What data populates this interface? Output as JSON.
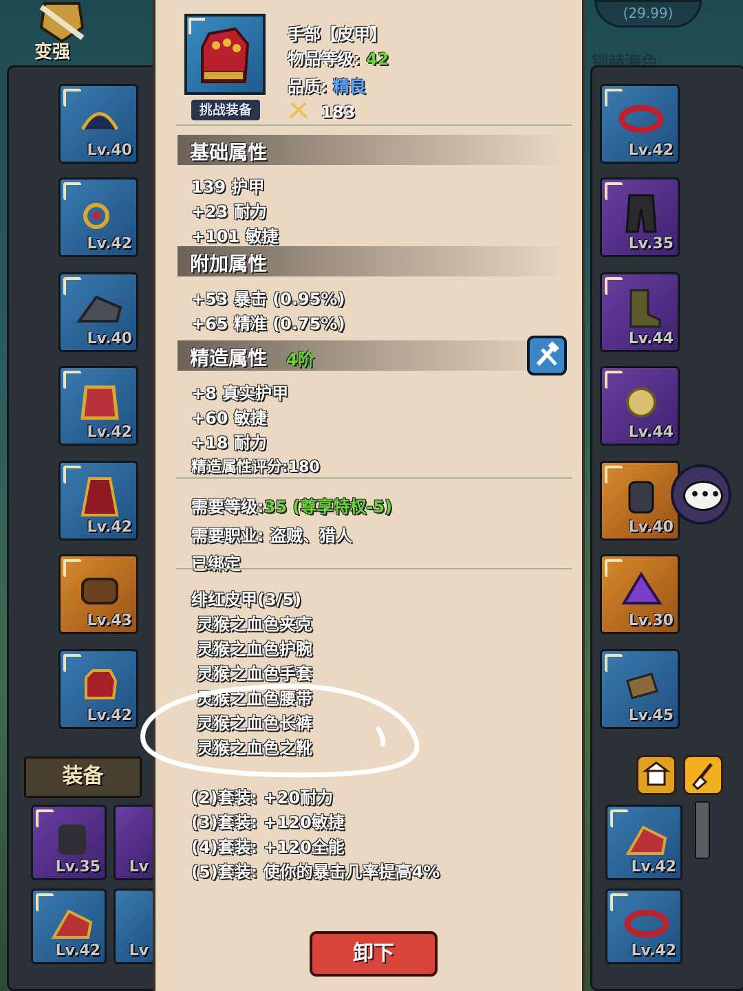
{
  "background": {
    "top_left_label": "变强",
    "top_right_value": "(29.99)",
    "top_right_text": "钏赫海色",
    "equip_tab_label": "装备",
    "left_slots": [
      "Lv.40",
      "Lv.42",
      "Lv.40",
      "Lv.42",
      "Lv.42",
      "Lv.43",
      "Lv.42"
    ],
    "right_slots": [
      "Lv.42",
      "Lv.35",
      "Lv.44",
      "Lv.44",
      "Lv.40",
      "Lv.30",
      "Lv.45"
    ],
    "bottom_left_slots": [
      "Lv.35",
      "Lv",
      "Lv.42",
      "Lv"
    ],
    "bottom_right_slots": [
      "Lv.42",
      "Lv.42"
    ]
  },
  "item": {
    "icon": "red-glove-icon",
    "challenge_label": "挑战装备",
    "name": "手部【皮甲】",
    "level_label": "物品等级:",
    "level_value": "42",
    "quality_label": "品质:",
    "quality_value": "精良",
    "score": "183"
  },
  "base": {
    "title": "基础属性",
    "lines": [
      "139 护甲",
      "+23 耐力",
      "+101 敏捷"
    ]
  },
  "extra": {
    "title": "附加属性",
    "lines": [
      "+53 暴击 (0.95%)",
      "+65 精准 (0.75%)"
    ]
  },
  "craft": {
    "title": "精造属性",
    "tier": "4阶",
    "lines": [
      "+8 真实护甲",
      "+60 敏捷",
      "+18 耐力"
    ],
    "score": "精造属性评分:180"
  },
  "requirements": {
    "level_label": "需要等级:",
    "level_value": "35 (尊享特权-5)",
    "class": "需要职业: 盗贼、猎人",
    "bound": "已绑定"
  },
  "set": {
    "title": "绯红皮甲(3/5)",
    "pieces": [
      {
        "name": "灵猴之血色夹克",
        "owned": true
      },
      {
        "name": "灵猴之血色护腕",
        "owned": false
      },
      {
        "name": "灵猴之血色手套",
        "owned": true
      },
      {
        "name": "灵猴之血色腰带",
        "owned": true
      },
      {
        "name": "灵猴之血色长裤",
        "owned": false
      },
      {
        "name": "灵猴之血色之靴",
        "owned": false
      }
    ],
    "bonuses": [
      {
        "text": "(2)套装: +20耐力",
        "active": true
      },
      {
        "text": "(3)套装: +120敏捷",
        "active": true
      },
      {
        "text": "(4)套装: +120全能",
        "active": false
      },
      {
        "text": "(5)套装: 使你的暴击几率提高4%",
        "active": false
      }
    ]
  },
  "actions": {
    "unequip_label": "卸下"
  },
  "colors": {
    "panel_bg": "#ead8c2",
    "green": "#6cd23a",
    "pink": "#ff4f6e",
    "gold": "#f2c326",
    "purple": "#c35cf0",
    "quality_blue": "#5aa8ff"
  }
}
